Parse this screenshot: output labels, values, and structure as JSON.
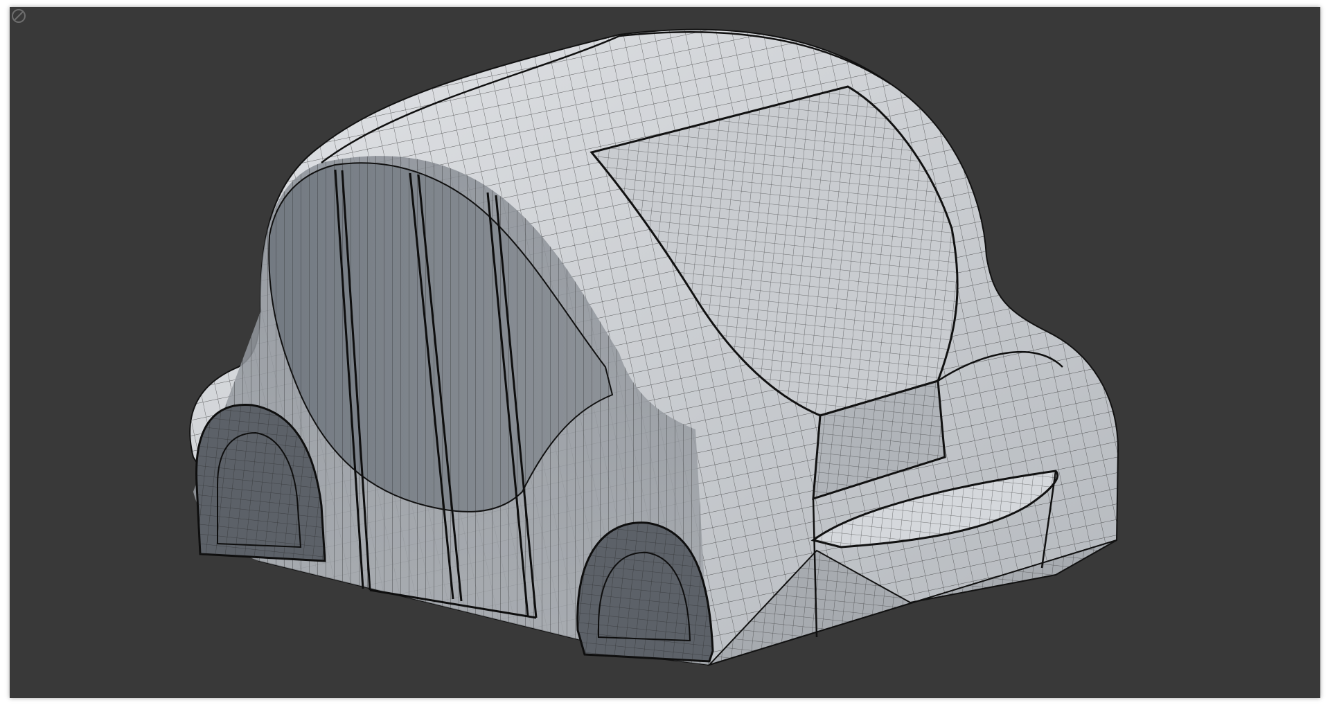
{
  "viewport": {
    "background_color": "#393939",
    "model": {
      "body_color": "#b9bcc0",
      "glass_color": "#6e747c",
      "wireframe_color": "#1a1a1a"
    },
    "corner_icon": "view-gizmo-icon"
  }
}
